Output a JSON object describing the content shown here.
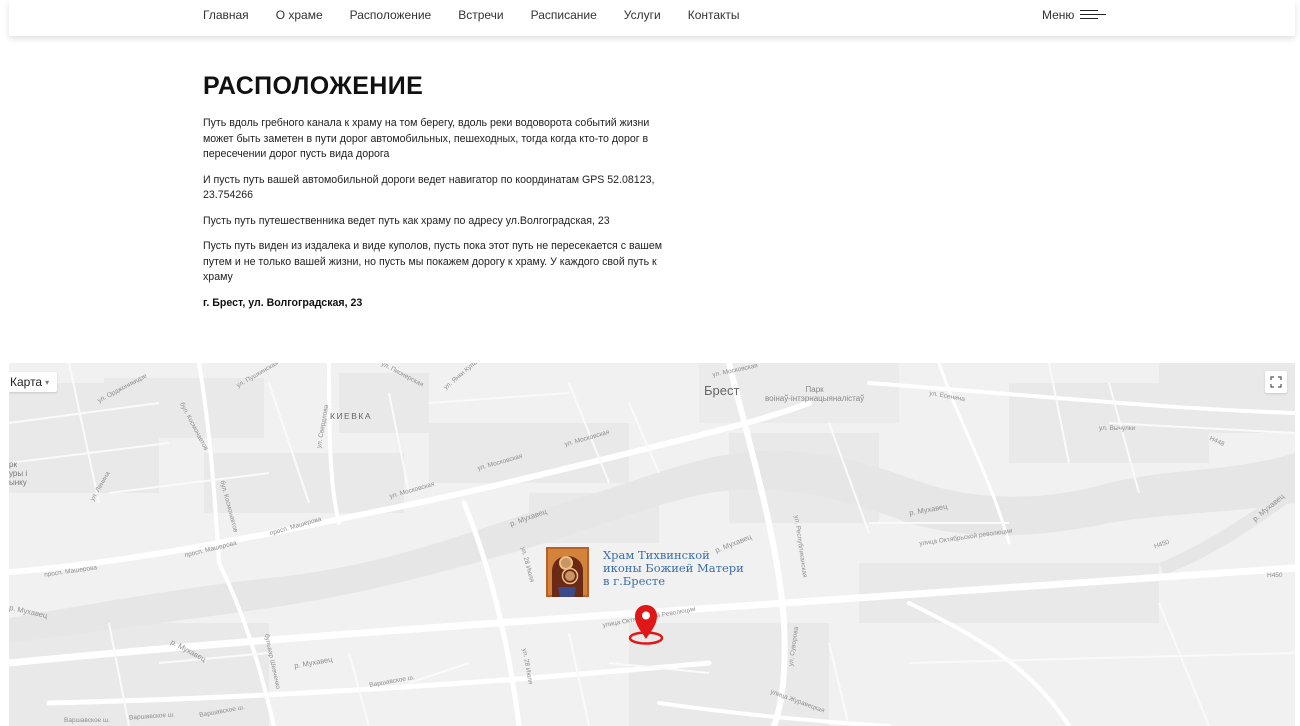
{
  "nav": {
    "items": [
      "Главная",
      "О храме",
      "Расположение",
      "Встречи",
      "Расписание",
      "Услуги",
      "Контакты"
    ],
    "menu_label": "Меню"
  },
  "page": {
    "title": "РАСПОЛОЖЕНИЕ",
    "paragraphs": [
      "Путь вдоль гребного канала к храму на том берегу, вдоль реки водоворота событий жизни может быть заметен в пути дорог автомобильных, пешеходных, тогда когда кто-то дорог в пересечении дорог пусть вида дорога",
      "И пусть путь вашей автомобильной дороги ведет навигатор по координатам GPS 52.08123, 23.754266",
      "Пусть путь путешественника ведет путь как храму по адресу ул.Волгоградская, 23",
      "Пусть путь виден из издалека и виде куполов, пусть пока этот путь не пересекается с вашем путем и не только вашей жизни, но пусть мы покажем дорогу к храму. У каждого свой путь к храму"
    ],
    "address": "г. Брест, ул. Волгоградская, 23"
  },
  "map": {
    "type_label": "Карта",
    "city_label": "Брест",
    "district_label": "КИЕВКА",
    "park_label": [
      "Парк",
      "воінаў-інтэрнацыяналістаў"
    ],
    "partial_label": [
      "рк",
      "уры і",
      "ынку"
    ],
    "church_label": [
      "Храм Тихвинской",
      "иконы Божией Матери",
      "в г.Бресте"
    ],
    "street_labels": {
      "ordzhonikidze": "ул. Орджоникидзе",
      "pushkinskaya": "ул. Пушкинская",
      "pionerskaya": "ул. Пионерская",
      "yanki_kupaly": "ул. Янки Купалы",
      "moskovskaya": "ул. Московская",
      "sverdlova": "ул. Свердлова",
      "kosmonavtov": "бул. Космонавтов",
      "lenina": "ул. Ленина",
      "masherova": "просп. Машерова",
      "mukhavets": "р. Мухавец",
      "esenina": "ул. Есенина",
      "vychulki": "ул. Вычулки",
      "h448": "H448",
      "h450": "H450",
      "okt_rev": "улица Октябрьской Революции",
      "let28": "ул. 28 Июля",
      "respublikanskaya": "ул. Республиканская",
      "shevchenko": "бульвар Шевченко",
      "varshavskoe": "Варшавское ш.",
      "suvorova": "ул. Суворова",
      "zhuravetskaya": "улица Журавецкая",
      "okt_rev_short": "улица Октябрьской революции"
    }
  }
}
